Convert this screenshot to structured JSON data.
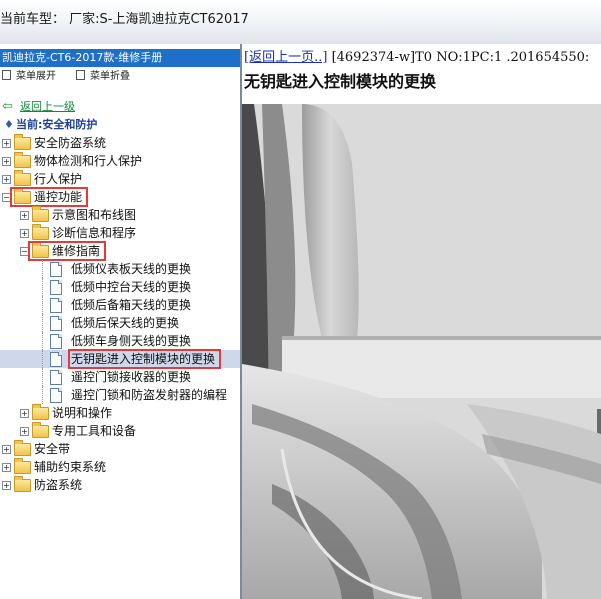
{
  "header": {
    "title": "当前车型：  厂家:S-上海凯迪拉克CT62017"
  },
  "left_panel": {
    "title": "凯迪拉克-CT6-2017款-维修手册",
    "toolbar": {
      "expand_all": "菜单展开",
      "collapse_all": "菜单折叠"
    },
    "back_link": "返回上一级",
    "current": "当前:安全和防护",
    "tree": [
      {
        "label": "安全防盗系统",
        "kind": "folder",
        "level": 0,
        "expander": "+"
      },
      {
        "label": "物体检测和行人保护",
        "kind": "folder",
        "level": 0,
        "expander": "+"
      },
      {
        "label": "行人保护",
        "kind": "folder",
        "level": 0,
        "expander": "+"
      },
      {
        "label": "遥控功能",
        "kind": "folder",
        "level": 0,
        "expander": "-",
        "highlighted": true
      },
      {
        "label": "示意图和布线图",
        "kind": "folder",
        "level": 1,
        "expander": "+"
      },
      {
        "label": "诊断信息和程序",
        "kind": "folder",
        "level": 1,
        "expander": "+"
      },
      {
        "label": "维修指南",
        "kind": "folder",
        "level": 1,
        "expander": "-",
        "highlighted": true
      },
      {
        "label": "低频仪表板天线的更换",
        "kind": "doc",
        "level": 2
      },
      {
        "label": "低频中控台天线的更换",
        "kind": "doc",
        "level": 2
      },
      {
        "label": "低频后备箱天线的更换",
        "kind": "doc",
        "level": 2
      },
      {
        "label": "低频后保天线的更换",
        "kind": "doc",
        "level": 2
      },
      {
        "label": "低频车身侧天线的更换",
        "kind": "doc",
        "level": 2
      },
      {
        "label": "无钥匙进入控制模块的更换",
        "kind": "doc",
        "level": 2,
        "highlighted": true,
        "selected": true
      },
      {
        "label": "遥控门锁接收器的更换",
        "kind": "doc",
        "level": 2
      },
      {
        "label": "遥控门锁和防盗发射器的编程",
        "kind": "doc",
        "level": 2
      },
      {
        "label": "说明和操作",
        "kind": "folder",
        "level": 1,
        "expander": "+"
      },
      {
        "label": "专用工具和设备",
        "kind": "folder",
        "level": 1,
        "expander": "+"
      },
      {
        "label": "安全带",
        "kind": "folder",
        "level": 0,
        "expander": "+"
      },
      {
        "label": "辅助约束系统",
        "kind": "folder",
        "level": 0,
        "expander": "+"
      },
      {
        "label": "防盗系统",
        "kind": "folder",
        "level": 0,
        "expander": "+"
      }
    ]
  },
  "content": {
    "back_link": "[返回上一页..]",
    "doc_meta": "[4692374-w]T0 NO:1PC:1 .201654550:",
    "title": "无钥匙进入控制模块的更换"
  },
  "colors": {
    "accent": "#1e6fc7",
    "highlight": "#e23b3b",
    "link_green": "#0a8a3a"
  }
}
